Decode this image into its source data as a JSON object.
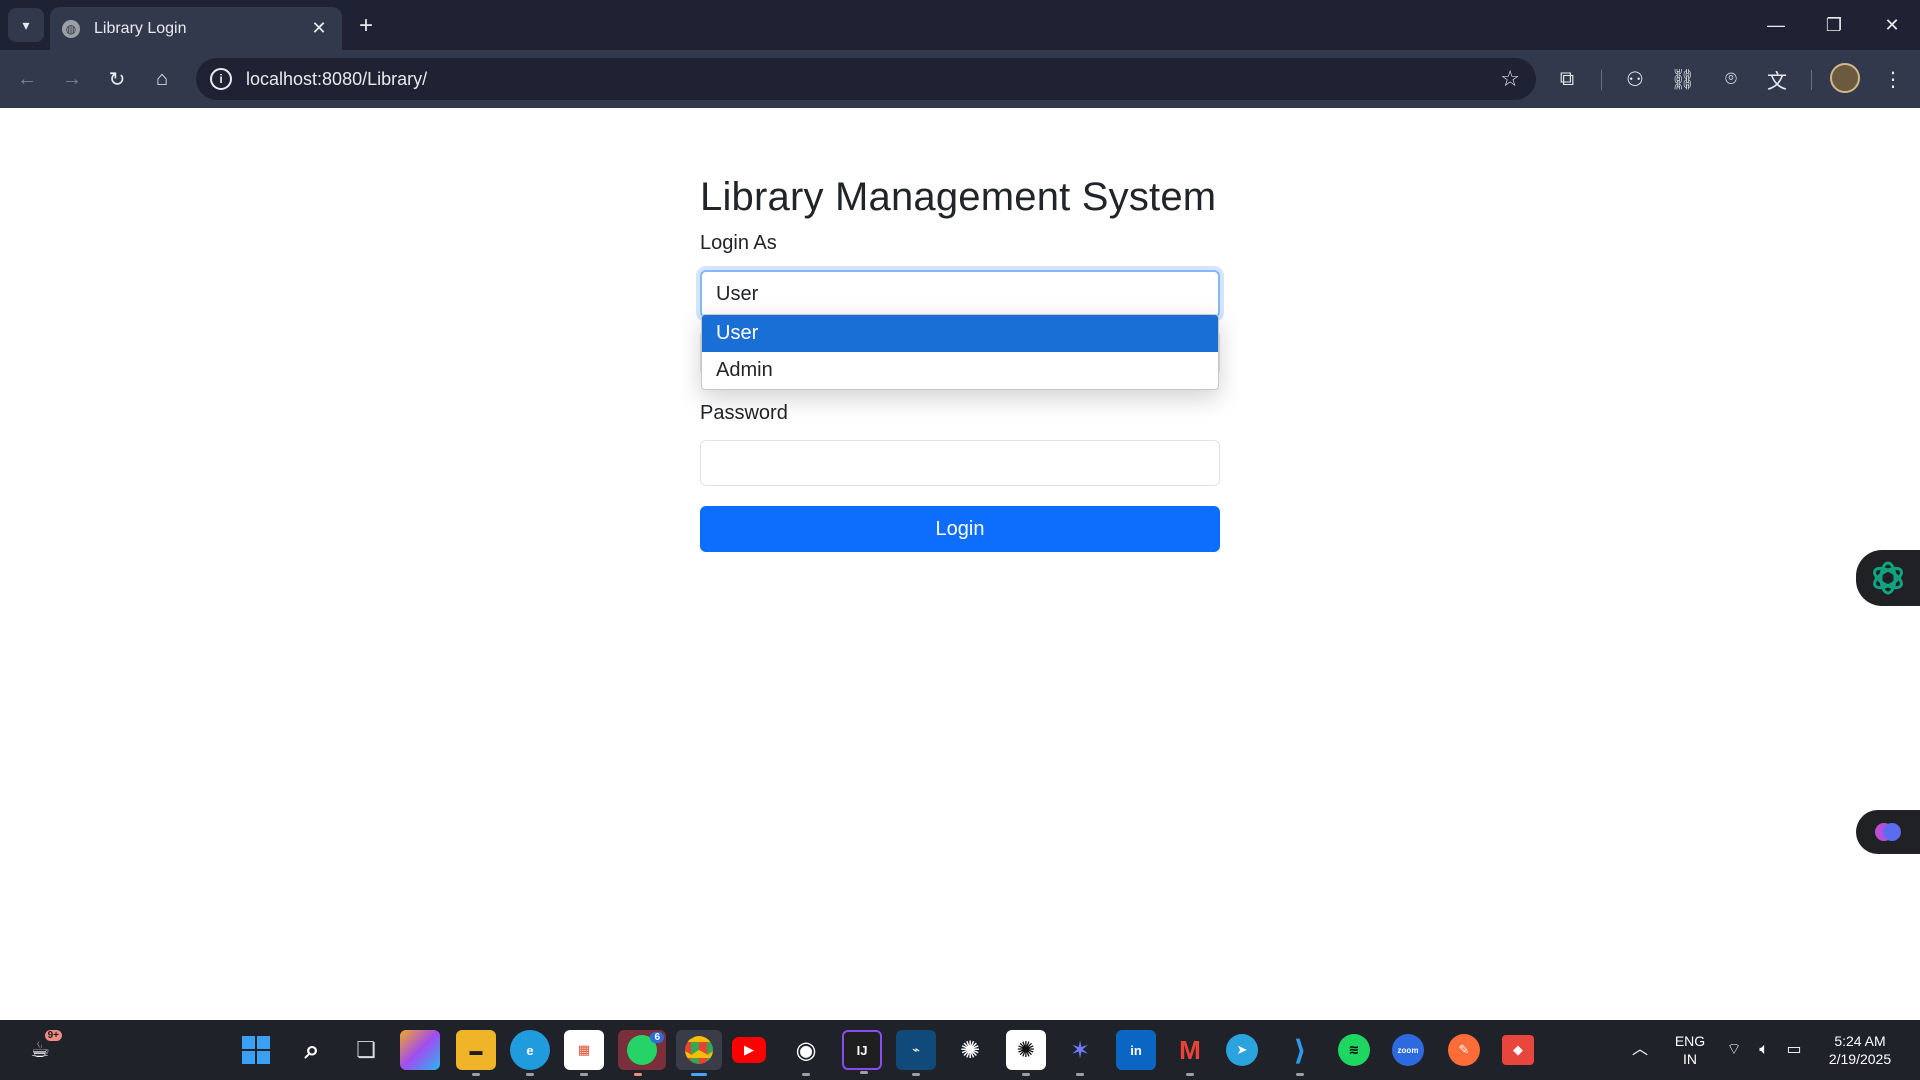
{
  "browser": {
    "tab_title": "Library Login",
    "url": "localhost:8080/Library/",
    "new_tab_symbol": "+",
    "window_controls": [
      "minimize",
      "restore",
      "close"
    ]
  },
  "page": {
    "heading": "Library Management System",
    "login_as_label": "Login As",
    "login_as_value": "User",
    "options": [
      "User",
      "Admin"
    ],
    "password_label": "Password",
    "login_button": "Login"
  },
  "taskbar": {
    "notification_badge": "9+",
    "whatsapp_badge": "6",
    "language_line1": "ENG",
    "language_line2": "IN",
    "time": "5:24 AM",
    "date": "2/19/2025"
  },
  "colors": {
    "primary": "#0d6efd",
    "selected_option": "#1a6fd6",
    "chrome_dark": "#1e2233",
    "chrome_toolbar": "#33394d"
  }
}
